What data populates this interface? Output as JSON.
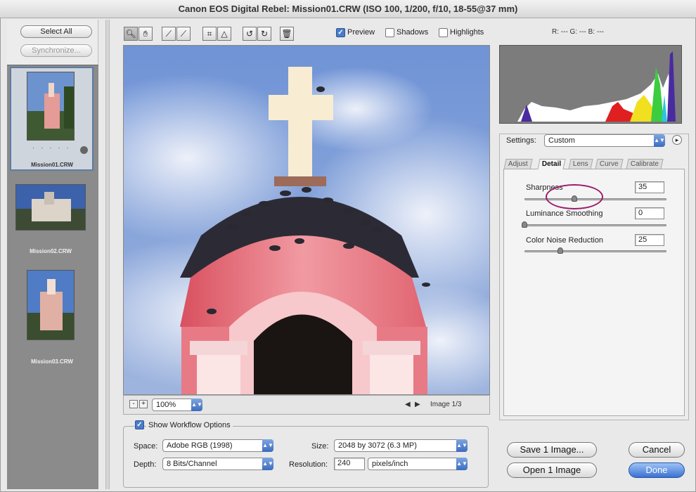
{
  "window": {
    "title": "Canon EOS Digital Rebel:  Mission01.CRW  (ISO 100, 1/200, f/10, 18-55@37 mm)"
  },
  "filmstrip": {
    "select_all": "Select All",
    "synchronize": "Synchronize...",
    "rating_dots": "· · · · ·",
    "thumbnails": [
      {
        "label": "Mission01.CRW"
      },
      {
        "label": "Mission02.CRW"
      },
      {
        "label": "Mission03.CRW"
      }
    ]
  },
  "toolbar": {
    "tools": [
      "zoom-tool-icon",
      "hand-tool-icon",
      "white-balance-tool-icon",
      "color-sampler-tool-icon",
      "crop-tool-icon",
      "straighten-tool-icon",
      "rotate-left-icon",
      "rotate-right-icon",
      "trash-icon"
    ],
    "preview_label": "Preview",
    "shadows_label": "Shadows",
    "highlights_label": "Highlights",
    "rgb_readout": "R: ---   G: ---   B: ---"
  },
  "preview": {
    "zoom_value": "100%",
    "zoom_out": "-",
    "zoom_in": "+",
    "prev": "◀",
    "next": "▶",
    "image_counter": "Image 1/3"
  },
  "settings": {
    "label": "Settings:",
    "value": "Custom",
    "tabs": [
      "Adjust",
      "Detail",
      "Lens",
      "Curve",
      "Calibrate"
    ],
    "active_tab": "Detail",
    "sliders": [
      {
        "label": "Sharpness",
        "value": "35",
        "fraction": 0.35
      },
      {
        "label": "Luminance Smoothing",
        "value": "0",
        "fraction": 0.0
      },
      {
        "label": "Color Noise Reduction",
        "value": "25",
        "fraction": 0.25
      }
    ]
  },
  "workflow": {
    "show_label": "Show Workflow Options",
    "space_label": "Space:",
    "space_value": "Adobe RGB (1998)",
    "depth_label": "Depth:",
    "depth_value": "8 Bits/Channel",
    "size_label": "Size:",
    "size_value": "2048 by 3072  (6.3 MP)",
    "resolution_label": "Resolution:",
    "resolution_value": "240",
    "resolution_unit": "pixels/inch"
  },
  "buttons": {
    "save": "Save 1 Image...",
    "open": "Open 1 Image",
    "cancel": "Cancel",
    "done": "Done"
  },
  "colors": {
    "accent": "#3a72d2",
    "highlight_circle": "#9b1b6b"
  }
}
